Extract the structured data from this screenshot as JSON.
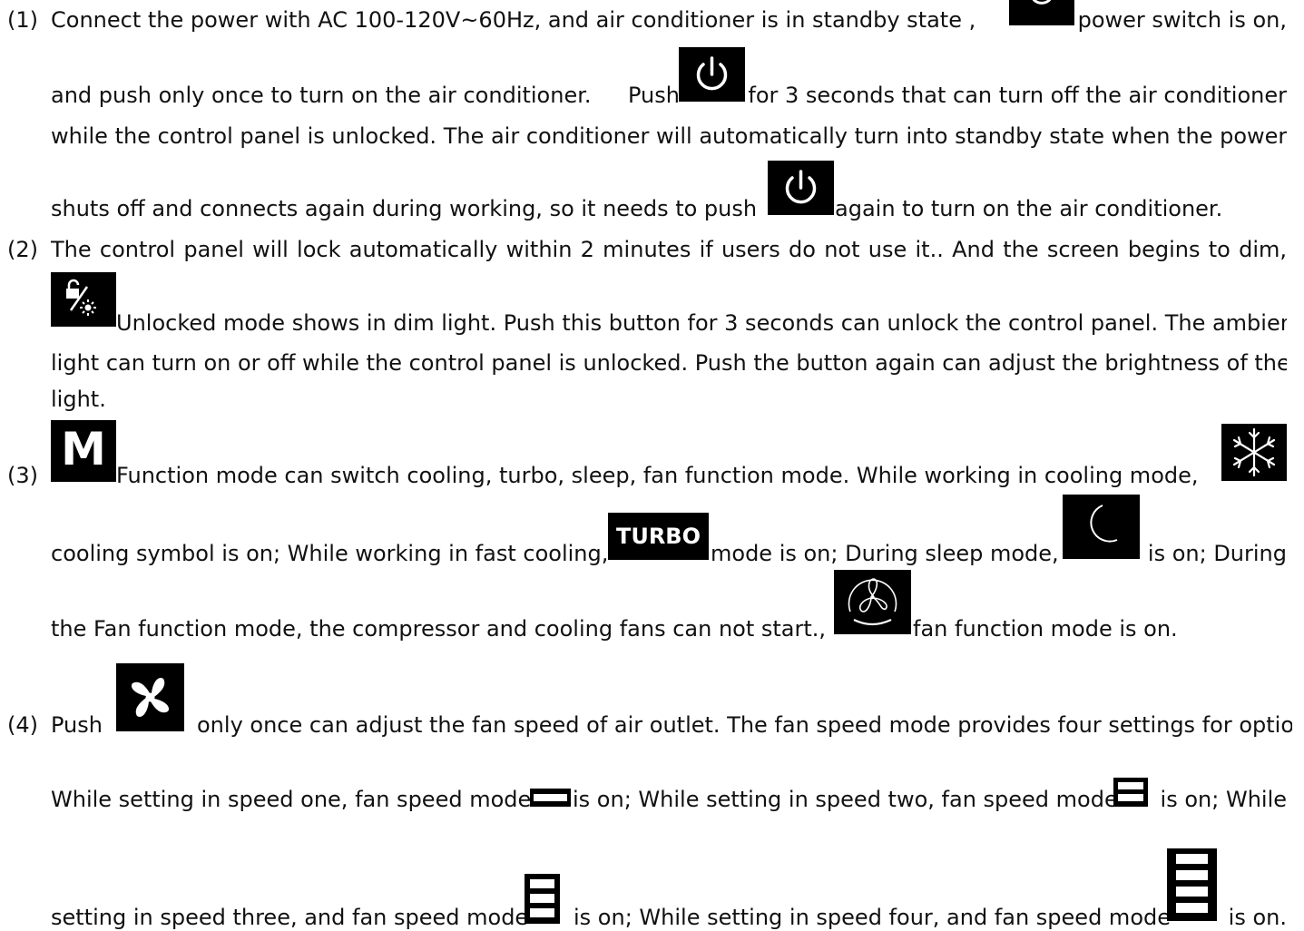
{
  "items": [
    {
      "number": "(1)",
      "lines": [
        {
          "a": "Connect the power with AC 100-120V~60Hz, and air conditioner is in standby state ,",
          "b": "power switch is on,"
        },
        {
          "a": "and push only once to turn on the air conditioner.",
          "b": "Push",
          "c": "for 3 seconds that can turn off the air conditioner"
        },
        {
          "a": "while the control panel is unlocked. The air conditioner will automatically turn into standby state when the power"
        },
        {
          "a": "shuts off and connects again during working, so it needs to push",
          "b": "again to turn on the air conditioner."
        }
      ]
    },
    {
      "number": "(2)",
      "lines": [
        {
          "a": "The control panel will lock automatically within 2 minutes if users do not use it.. And the screen begins to dim,"
        },
        {
          "a": "Unlocked mode shows in dim light. Push this button for 3 seconds can unlock the control panel. The ambient"
        },
        {
          "a": "light can turn on or off while the control panel is unlocked. Push the button again can adjust the brightness of the"
        },
        {
          "a": "light."
        }
      ]
    },
    {
      "number": "(3)",
      "lines": [
        {
          "a": "Function mode can switch cooling, turbo, sleep, fan function mode. While working in cooling mode,"
        },
        {
          "a": "cooling symbol is on; While working in fast cooling,",
          "b": "mode is on; During sleep mode,",
          "c": "is on; During"
        },
        {
          "a": "the Fan function mode, the compressor and cooling fans can not start.,",
          "b": "fan function mode is on."
        }
      ]
    },
    {
      "number": "(4)",
      "lines": [
        {
          "a": "Push",
          "b": "only once can adjust the fan speed of air outlet. The fan speed mode provides four settings for options."
        },
        {
          "a": "While setting in speed one, fan speed mode",
          "b": "is on; While setting in speed two, fan speed mode",
          "c": "is on; While"
        },
        {
          "a": "setting in speed three, and fan speed mode",
          "b": "is on; While setting in speed four, and fan speed mode",
          "c": "is on."
        }
      ]
    }
  ],
  "icons": {
    "power": "power-icon",
    "lock_light": "lock-light-icon",
    "mode_m": "M",
    "snowflake": "snowflake-icon",
    "turbo": "TURBO",
    "moon": "moon-icon",
    "fan_mode": "fan-mode-icon",
    "fan_speed": "fan-speed-icon",
    "speed_one": "speed-one-icon",
    "speed_two": "speed-two-icon",
    "speed_three": "speed-three-icon",
    "speed_four": "speed-four-icon"
  }
}
